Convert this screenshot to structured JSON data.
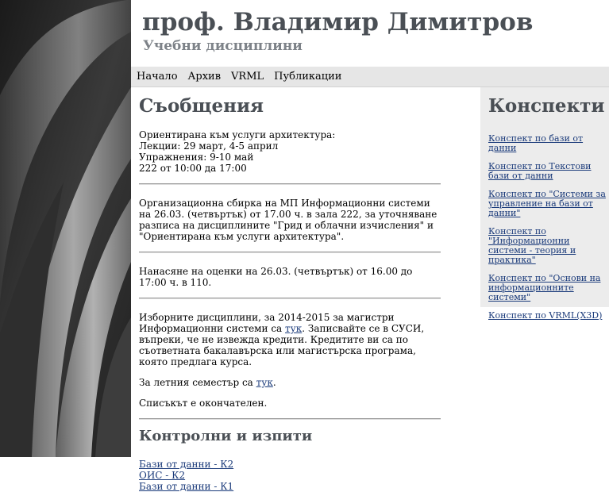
{
  "header": {
    "title": "проф. Владимир Димитров",
    "subtitle": "Учебни дисциплини"
  },
  "nav": {
    "items": [
      {
        "label": "Начало"
      },
      {
        "label": "Архив"
      },
      {
        "label": "VRML"
      },
      {
        "label": "Публикации"
      }
    ]
  },
  "main": {
    "messages_title": "Съобщения",
    "notice1": {
      "lines": [
        "Ориентирана към услуги архитектура:",
        "Лекции: 29 март, 4-5 април",
        "Упражнения: 9-10 май",
        "222 от 10:00 да 17:00"
      ]
    },
    "notice2": "Организационна сбирка на МП Информационни системи на 26.03. (четвъртък) от 17.00 ч. в зала 222, за уточняване разписа на дисциплините \"Грид и облачни изчисления\" и \"Ориентирана към услуги архитектура\".",
    "notice3": "Нанасяне на оценки на 26.03. (четвъртък) от 16.00 до 17:00 ч. в 110.",
    "notice4": {
      "p1_before": "Изборните дисциплини, за 2014-2015 за магистри Информационни системи са ",
      "p1_link": "тук",
      "p1_after": ". Записвайте се в СУСИ, въпреки, че не извежда кредити. Кредитите ви са по съответната бакалавърска или магистърска програма, която предлага курса.",
      "p2_before": "За летния семестър са ",
      "p2_link": "тук",
      "p2_after": ".",
      "p3": "Списъкът е окончателен."
    },
    "exams_title": "Контролни и изпити",
    "exam_links": [
      "Бази от данни - К2",
      "ОИС - К2",
      "Бази от данни - К1"
    ]
  },
  "sidebar": {
    "title": "Конспекти",
    "links": [
      "Конспект по бази от данни",
      "Конспект по Текстови бази от данни",
      "Конспект по \"Системи за управление на бази от данни\"",
      "Конспект по \"Информационни системи - теория и практика\"",
      "Конспект по \"Основи на информационните системи\"",
      "Конспект по VRML(X3D)"
    ]
  },
  "colors": {
    "heading": "#4a4f55",
    "subtitle": "#7d8288",
    "nav_bg": "#e6e6e6",
    "sidebar_bg": "#ececec",
    "link": "#1a3a7a"
  }
}
